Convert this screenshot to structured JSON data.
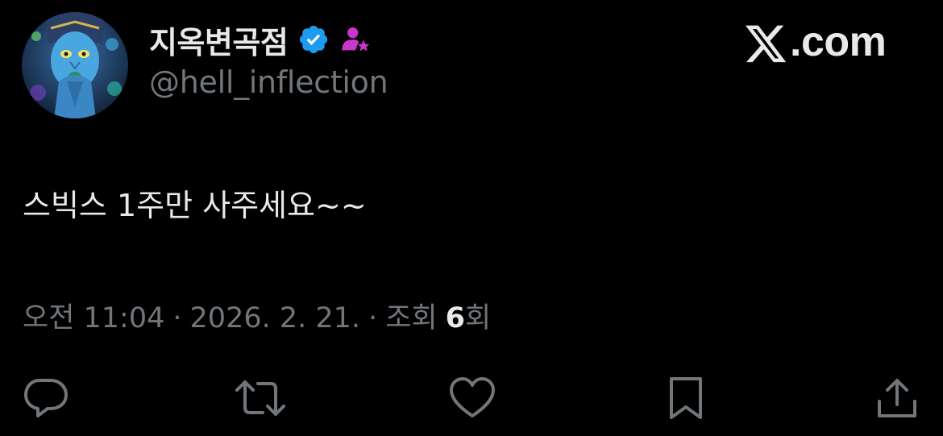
{
  "author": {
    "display_name": "지옥변곡점",
    "handle": "@hell_inflection",
    "verified_badge_color": "#1d9bf0",
    "affiliate_badge_color": "#c936cc",
    "avatar_icon": "avatar-image"
  },
  "site": {
    "domain_text": ".com",
    "logo_icon": "x-logo-icon"
  },
  "tweet": {
    "text": "스빅스 1주만 사주세요~~"
  },
  "meta": {
    "time": "오전 11:04",
    "separator": "·",
    "date": "2026. 2. 21.",
    "views_label": "조회",
    "views_count": "6",
    "views_suffix": "회"
  },
  "actions": [
    {
      "name": "reply",
      "icon": "reply-icon"
    },
    {
      "name": "repost",
      "icon": "repost-icon"
    },
    {
      "name": "like",
      "icon": "heart-icon"
    },
    {
      "name": "bookmark",
      "icon": "bookmark-icon"
    },
    {
      "name": "share",
      "icon": "share-icon"
    }
  ],
  "colors": {
    "background": "#000000",
    "text_primary": "#e7e9ea",
    "text_secondary": "#71767b"
  }
}
